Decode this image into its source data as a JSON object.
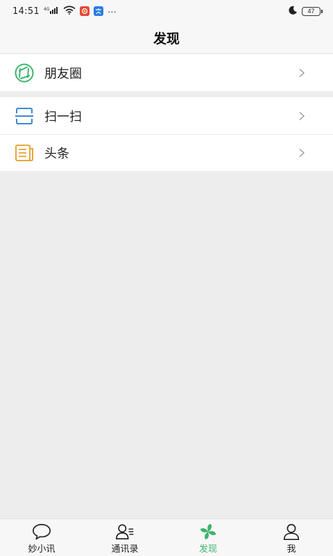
{
  "status_bar": {
    "time": "14:51",
    "signal_text": "4G",
    "app_badge_1": "",
    "app_badge_2": "",
    "more": "···",
    "battery": "47"
  },
  "header": {
    "title": "发现"
  },
  "groups": [
    {
      "items": [
        {
          "label": "朋友圈",
          "icon": "moments-icon"
        }
      ]
    },
    {
      "items": [
        {
          "label": "扫一扫",
          "icon": "scan-icon"
        },
        {
          "label": "头条",
          "icon": "news-icon"
        }
      ]
    }
  ],
  "tabbar": {
    "tabs": [
      {
        "label": "妙小讯",
        "icon": "chat-bubble-icon",
        "active": false
      },
      {
        "label": "通讯录",
        "icon": "contacts-icon",
        "active": false
      },
      {
        "label": "发现",
        "icon": "discover-pinwheel-icon",
        "active": true
      },
      {
        "label": "我",
        "icon": "profile-icon",
        "active": false
      }
    ]
  },
  "colors": {
    "accent": "#3fb46c",
    "moments": "#3fb46c",
    "scan": "#3f86d6",
    "news": "#e8a53a",
    "background": "#ededed"
  }
}
